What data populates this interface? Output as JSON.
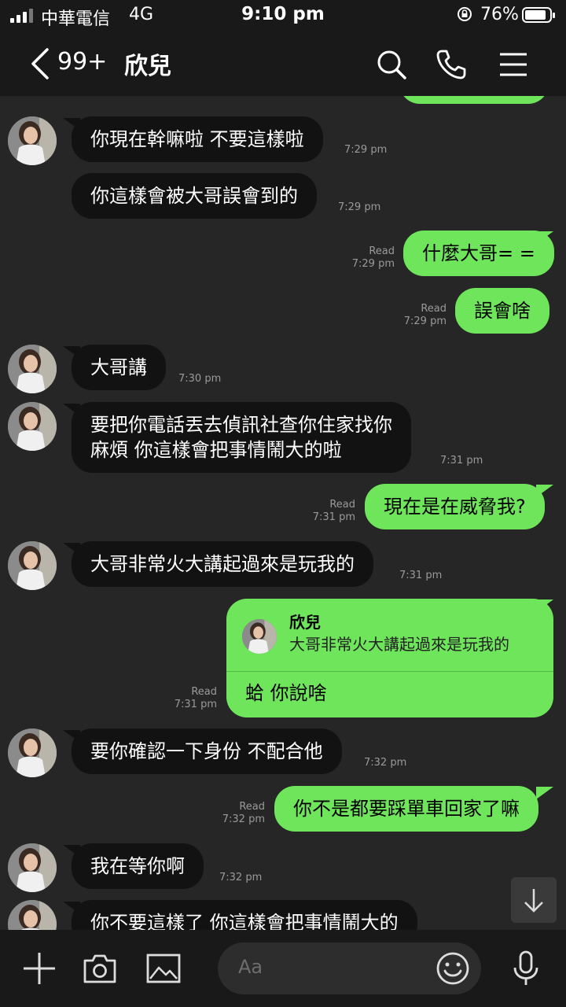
{
  "status_bar": {
    "carrier": "中華電信",
    "network": "4G",
    "time": "9:10 pm",
    "battery": "76%"
  },
  "header": {
    "unread_count": "99+",
    "contact_name": "欣兒"
  },
  "messages": [
    {
      "text": "你現在幹嘛啦 不要這樣啦",
      "time": "7:29 pm"
    },
    {
      "text": "你這樣會被大哥誤會到的",
      "time": "7:29 pm"
    },
    {
      "text": "什麼大哥= =",
      "read": "Read",
      "time": "7:29 pm"
    },
    {
      "text": "誤會啥",
      "read": "Read",
      "time": "7:29 pm"
    },
    {
      "text": "大哥講",
      "time": "7:30 pm"
    },
    {
      "line1": "要把你電話丟去偵訊社查你住家找你",
      "line2": "麻煩 你這樣會把事情鬧大的啦",
      "time": "7:31 pm"
    },
    {
      "text": "現在是在威脅我?",
      "read": "Read",
      "time": "7:31 pm"
    },
    {
      "text": "大哥非常火大講起過來是玩我的",
      "time": "7:31 pm"
    },
    {
      "reply_name": "欣兒",
      "reply_text": "大哥非常火大講起過來是玩我的",
      "text": "蛤 你說啥",
      "read": "Read",
      "time": "7:31 pm"
    },
    {
      "text": "要你確認一下身份 不配合他",
      "time": "7:32 pm"
    },
    {
      "text": "你不是都要踩單車回家了嘛",
      "read": "Read",
      "time": "7:32 pm"
    },
    {
      "text": "我在等你啊",
      "time": "7:32 pm"
    },
    {
      "text": "你不要這樣了 你這樣會把事情鬧大的"
    }
  ],
  "input": {
    "placeholder": "Aa"
  },
  "colors": {
    "out_bubble": "#6ee55b",
    "in_bubble": "#121212",
    "background": "#262626",
    "bar": "#191919"
  }
}
